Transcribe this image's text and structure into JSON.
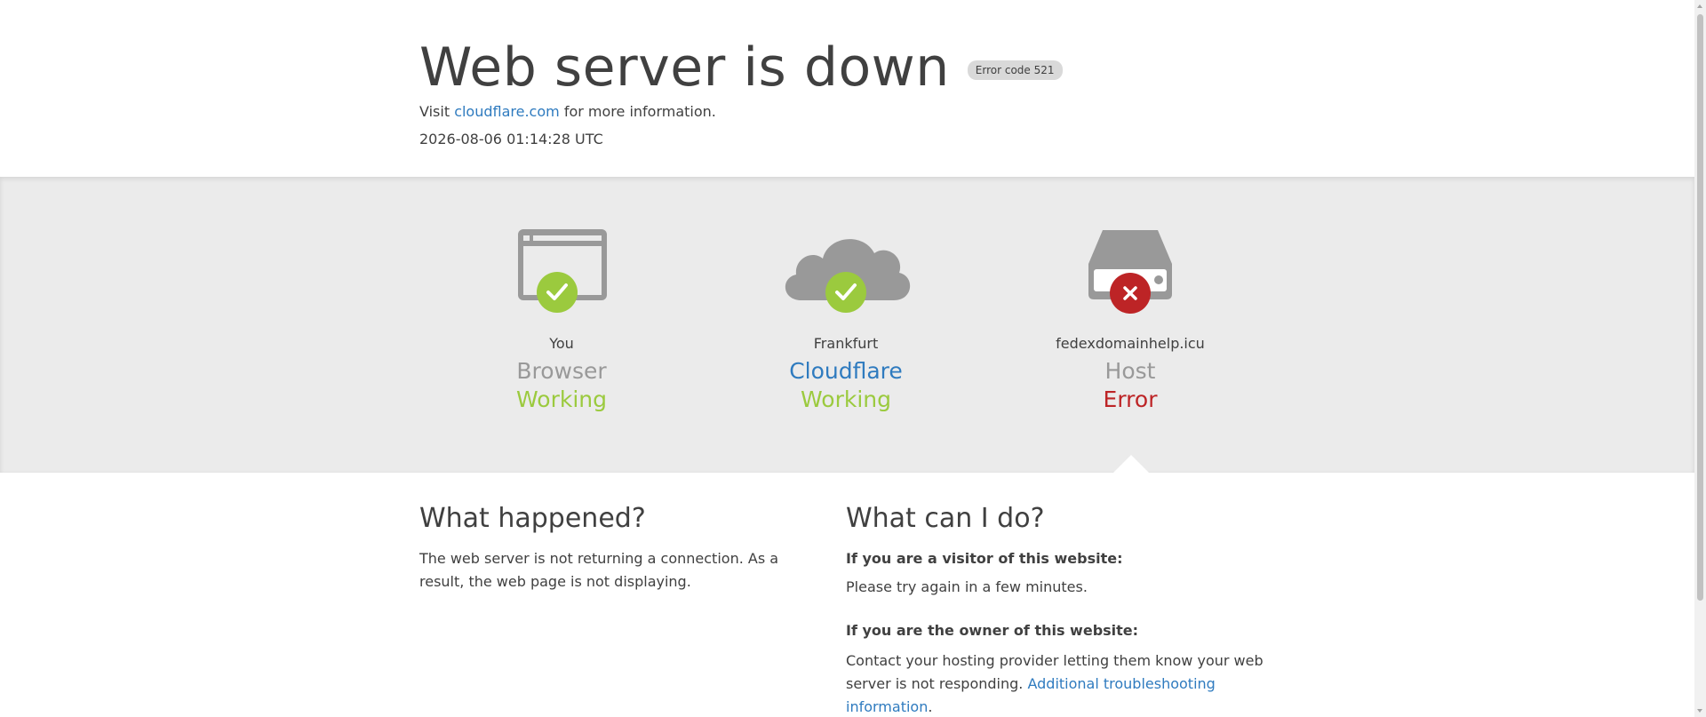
{
  "header": {
    "title": "Web server is down",
    "error_badge": "Error code 521",
    "visit_prefix": "Visit",
    "visit_link": "cloudflare.com",
    "visit_suffix": "for more information.",
    "timestamp": "2026-08-06 01:14:28 UTC"
  },
  "status_nodes": [
    {
      "location": "You",
      "name": "Browser",
      "status": "Working",
      "icon": "browser-icon",
      "state": "ok"
    },
    {
      "location": "Frankfurt",
      "name": "Cloudflare",
      "status": "Working",
      "icon": "cloud-icon",
      "state": "ok"
    },
    {
      "location": "fedexdomainhelp.icu",
      "name": "Host",
      "status": "Error",
      "icon": "server-icon",
      "state": "error"
    }
  ],
  "what_happened": {
    "heading": "What happened?",
    "body": "The web server is not returning a connection. As a result, the web page is not displaying."
  },
  "what_can_i_do": {
    "heading": "What can I do?",
    "visitor_heading": "If you are a visitor of this website:",
    "visitor_body": "Please try again in a few minutes.",
    "owner_heading": "If you are the owner of this website:",
    "owner_body": "Contact your hosting provider letting them know your web server is not responding.",
    "owner_link": "Additional troubleshooting information",
    "owner_suffix": "."
  },
  "colors": {
    "ok": "#9bca3e",
    "error": "#bd2426",
    "link": "#2f7bbf",
    "icon_gray": "#999999",
    "band": "#ebebeb"
  }
}
